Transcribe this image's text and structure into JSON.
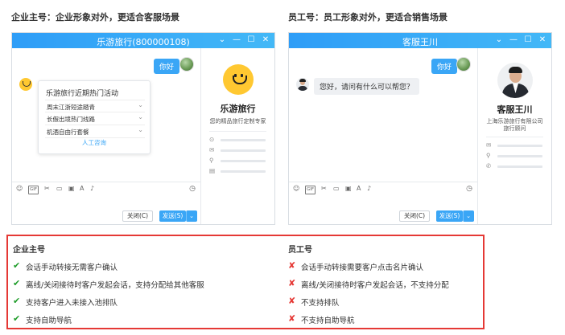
{
  "left": {
    "heading": "企业主号：企业形象对外，更适合客服场景",
    "window_title": "乐游旅行(800000108)",
    "my_message": "你好",
    "card": {
      "title": "乐游旅行近期热门活动",
      "options": [
        "周末江浙短途踏青",
        "长假出境热门线路",
        "机酒自由行套餐"
      ],
      "link": "人工咨询"
    },
    "profile": {
      "name": "乐游旅行",
      "desc": "您的精品旅行定制专家"
    },
    "buttons": {
      "close": "关闭(C)",
      "send": "发送(S)"
    }
  },
  "right": {
    "heading": "员工号：员工形象对外，更适合销售场景",
    "window_title": "客服王川",
    "my_message": "你好",
    "agent_message": "您好，请问有什么可以帮您？",
    "profile": {
      "name": "客服王川",
      "company": "上海乐游旅行有限公司",
      "role": "旅行顾问"
    },
    "buttons": {
      "close": "关闭(C)",
      "send": "发送(S)"
    }
  },
  "window_controls": {
    "dropdown": "⌄",
    "minimize": "—",
    "maximize": "☐",
    "close": "✕"
  },
  "comparison": {
    "enterprise": {
      "title": "企业主号",
      "items": [
        {
          "mark": "✔",
          "text": "会话手动转接无需客户确认"
        },
        {
          "mark": "✔",
          "text": "离线/关闭接待时客户发起会话，支持分配给其他客服"
        },
        {
          "mark": "✔",
          "text": "支持客户进入未接入池排队"
        },
        {
          "mark": "✔",
          "text": "支持自助导航"
        }
      ]
    },
    "employee": {
      "title": "员工号",
      "items": [
        {
          "mark": "✘",
          "text": "会话手动转接需要客户点击名片确认"
        },
        {
          "mark": "✘",
          "text": "离线/关闭接待时客户发起会话，不支持分配"
        },
        {
          "mark": "✘",
          "text": "不支持排队"
        },
        {
          "mark": "✘",
          "text": "不支持自助导航"
        }
      ]
    }
  },
  "colors": {
    "accent": "#3aa6f6",
    "ok": "#1f9d2a",
    "no": "#e53935",
    "brand_yellow": "#ffc831"
  },
  "icons": [
    "emoji-icon",
    "gif-icon",
    "scissors-icon",
    "folder-icon",
    "image-icon",
    "font-icon",
    "microphone-icon",
    "history-clock-icon",
    "location-icon",
    "mail-icon",
    "link-icon",
    "phone-icon",
    "note-icon"
  ]
}
